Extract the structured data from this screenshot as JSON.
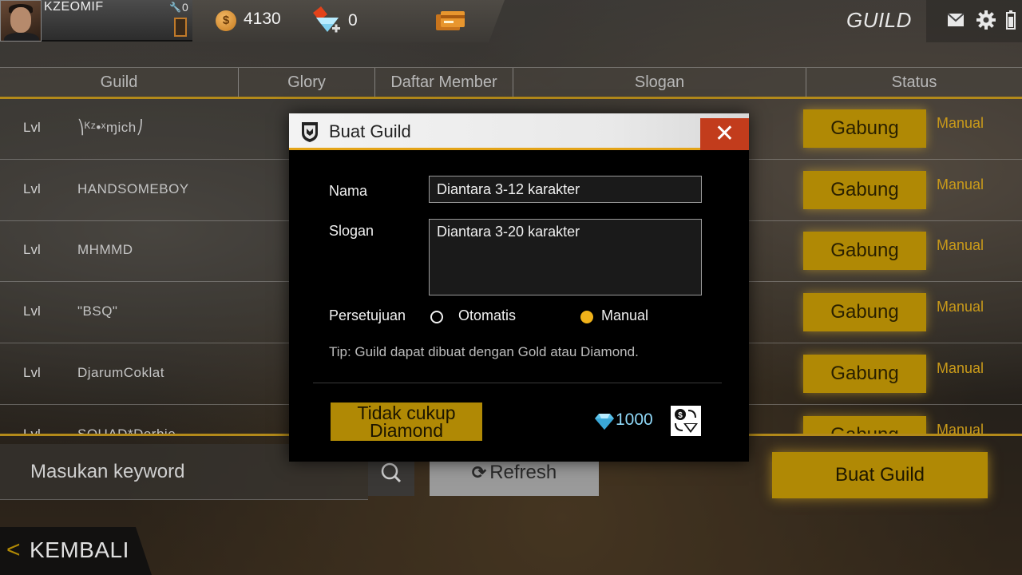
{
  "topbar": {
    "player_name": "KZEOMIF",
    "wrench_count": "0",
    "gold": "4130",
    "gold_symbol": "$",
    "diamonds": "0",
    "screen_title": "GUILD",
    "icons": [
      "avatar",
      "wrench-icon",
      "door-icon",
      "gold-coin-icon",
      "diamond-plus-icon",
      "card-icon",
      "mail-icon",
      "gear-icon",
      "battery-icon"
    ]
  },
  "table": {
    "headers": [
      "Guild",
      "Glory",
      "Daftar Member",
      "Slogan",
      "Status"
    ],
    "rows": [
      {
        "level": "Lvl",
        "name": "⎞ᴷᶻ•ˣɱich⎠",
        "action": "Gabung",
        "status": "Manual"
      },
      {
        "level": "Lvl",
        "name": "HANDSOMEBOY",
        "action": "Gabung",
        "status": "Manual"
      },
      {
        "level": "Lvl",
        "name": "MHMMD",
        "action": "Gabung",
        "status": "Manual"
      },
      {
        "level": "Lvl",
        "name": "\"BSQ\"",
        "action": "Gabung",
        "status": "Manual"
      },
      {
        "level": "Lvl",
        "name": "DjarumCoklat",
        "action": "Gabung",
        "status": "Manual"
      },
      {
        "level": "Lvl",
        "name": "SQUAD*Derbie",
        "action": "Gabung",
        "status": "Manual"
      }
    ]
  },
  "bottom": {
    "search_placeholder": "Masukan keyword",
    "refresh_icon": "⟳",
    "refresh_label": "Refresh",
    "create_label": "Buat Guild",
    "back_chevron": "<",
    "back_label": "KEMBALI"
  },
  "modal": {
    "title": "Buat Guild",
    "close_symbol": "✕",
    "name_label": "Nama",
    "name_placeholder": "Diantara 3-12 karakter",
    "slogan_label": "Slogan",
    "slogan_placeholder": "Diantara 3-20 karakter",
    "approval_label": "Persetujuan",
    "options": [
      {
        "label": "Otomatis",
        "selected": false
      },
      {
        "label": "Manual",
        "selected": true
      }
    ],
    "tip": "Tip: Guild dapat dibuat dengan Gold atau Diamond.",
    "button_line1": "Tidak cukup",
    "button_line2": "Diamond",
    "price": "1000",
    "exchange_symbol": "$"
  },
  "colors": {
    "accent_gold": "#b08905",
    "status_text": "#c99a1a",
    "close_red": "#c23c1c",
    "modal_underline": "#e4a418",
    "price_blue": "#8fd8f8"
  }
}
